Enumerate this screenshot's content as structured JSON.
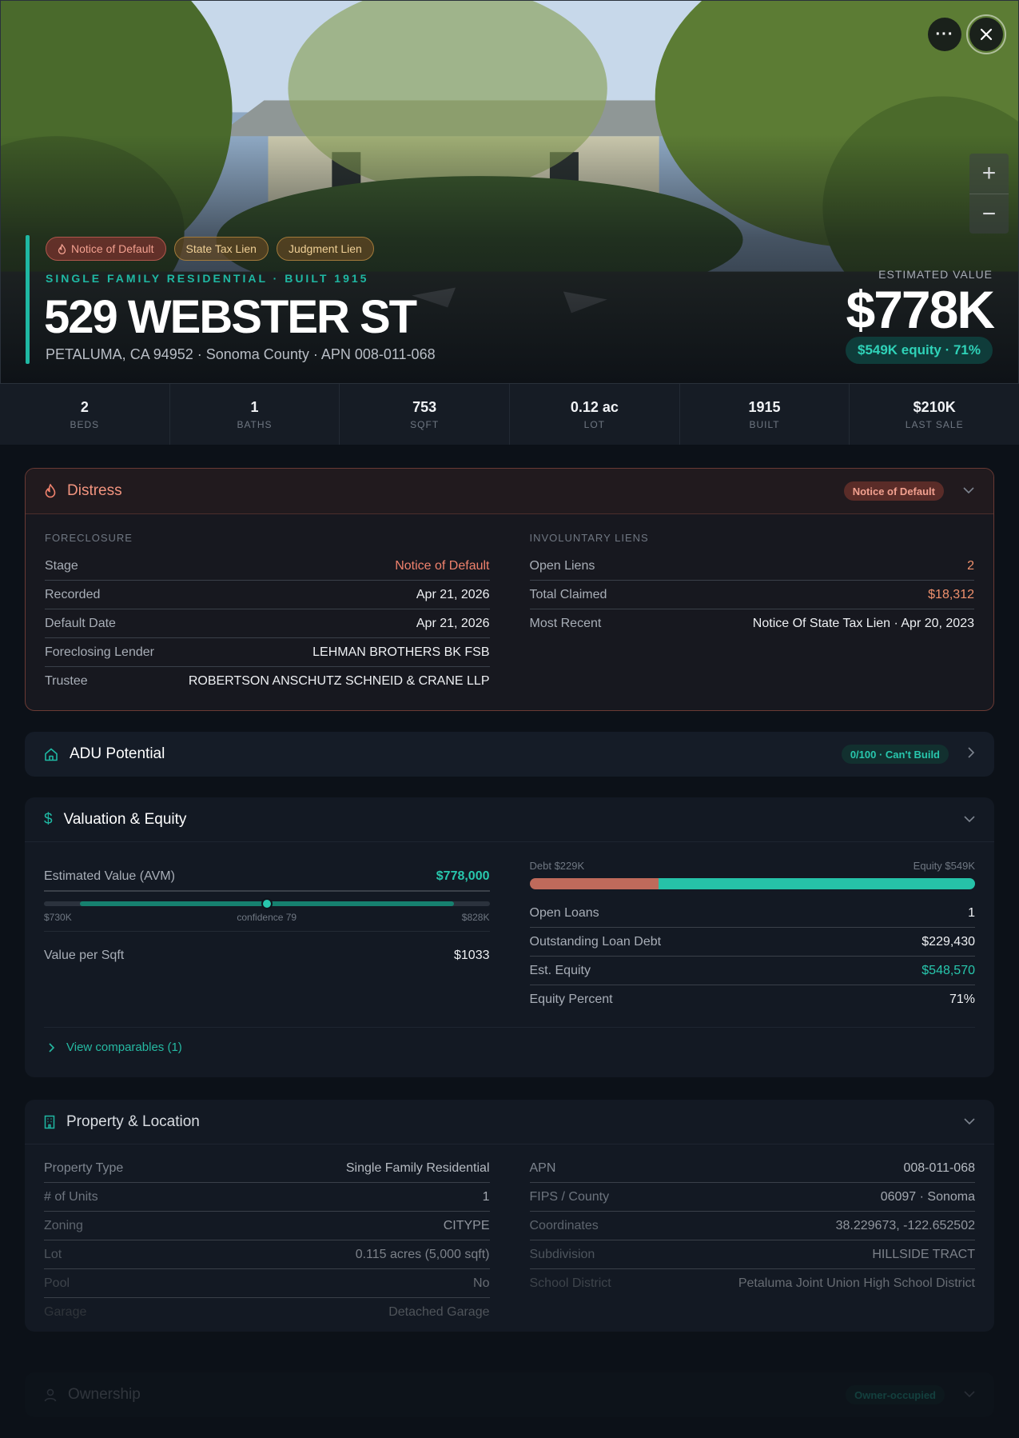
{
  "hero": {
    "badges": [
      "Notice of Default",
      "State Tax Lien",
      "Judgment Lien"
    ],
    "eyebrow": "SINGLE FAMILY RESIDENTIAL · BUILT 1915",
    "address": "529 WEBSTER ST",
    "subaddress": "PETALUMA, CA 94952 · Sonoma County · APN 008-011-068",
    "estimated_label": "ESTIMATED VALUE",
    "estimated_value": "$778K",
    "equity_pill": "$549K equity · 71%"
  },
  "stats": [
    {
      "value": "2",
      "label": "BEDS"
    },
    {
      "value": "1",
      "label": "BATHS"
    },
    {
      "value": "753",
      "label": "SQFT"
    },
    {
      "value": "0.12 ac",
      "label": "LOT"
    },
    {
      "value": "1915",
      "label": "BUILT"
    },
    {
      "value": "$210K",
      "label": "LAST SALE"
    }
  ],
  "distress": {
    "title": "Distress",
    "badge": "Notice of Default",
    "foreclosure_heading": "FORECLOSURE",
    "foreclosure": [
      {
        "k": "Stage",
        "v": "Notice of Default"
      },
      {
        "k": "Recorded",
        "v": "Apr 21, 2026"
      },
      {
        "k": "Default Date",
        "v": "Apr 21, 2026"
      },
      {
        "k": "Foreclosing Lender",
        "v": "LEHMAN BROTHERS BK FSB"
      },
      {
        "k": "Trustee",
        "v": "ROBERTSON ANSCHUTZ SCHNEID & CRANE LLP"
      }
    ],
    "liens_heading": "INVOLUNTARY LIENS",
    "liens": [
      {
        "k": "Open Liens",
        "v": "2"
      },
      {
        "k": "Total Claimed",
        "v": "$18,312"
      },
      {
        "k": "Most Recent",
        "v": "Notice Of State Tax Lien · Apr 20, 2023"
      }
    ]
  },
  "adu": {
    "title": "ADU Potential",
    "score": "0/100 · Can't Build"
  },
  "valuation": {
    "title": "Valuation & Equity",
    "avm_label": "Estimated Value (AVM)",
    "avm_value": "$778,000",
    "avm_low": "$730K",
    "avm_confidence": "confidence 79",
    "avm_high": "$828K",
    "avm_fraction": 0.5,
    "range_start_fraction": 0.08,
    "range_end_fraction": 0.92,
    "ppsf_label": "Value per Sqft",
    "ppsf_value": "$1033",
    "debt_label": "Debt $229K",
    "equity_label": "Equity $549K",
    "debt_fraction": 0.29,
    "loans": [
      {
        "k": "Open Loans",
        "v": "1"
      },
      {
        "k": "Outstanding Loan Debt",
        "v": "$229,430"
      },
      {
        "k": "Est. Equity",
        "v": "$548,570"
      },
      {
        "k": "Equity Percent",
        "v": "71%"
      }
    ],
    "comparables_link": "View comparables (1)"
  },
  "property": {
    "title": "Property & Location",
    "left": [
      {
        "k": "Property Type",
        "v": "Single Family Residential"
      },
      {
        "k": "# of Units",
        "v": "1"
      },
      {
        "k": "Zoning",
        "v": "CITYPE"
      },
      {
        "k": "Lot",
        "v": "0.115 acres (5,000 sqft)"
      },
      {
        "k": "Pool",
        "v": "No"
      },
      {
        "k": "Garage",
        "v": "Detached Garage"
      }
    ],
    "right": [
      {
        "k": "APN",
        "v": "008-011-068"
      },
      {
        "k": "FIPS / County",
        "v": "06097 · Sonoma"
      },
      {
        "k": "Coordinates",
        "v": "38.229673, -122.652502"
      },
      {
        "k": "Subdivision",
        "v": "HILLSIDE TRACT"
      },
      {
        "k": "School District",
        "v": "Petaluma Joint Union High School District"
      }
    ]
  },
  "ownership": {
    "title": "Ownership",
    "badge": "Owner-occupied"
  },
  "colors": {
    "accent": "#1fb8a3",
    "distress": "#f0826d",
    "debt": "#bf6a5b"
  }
}
